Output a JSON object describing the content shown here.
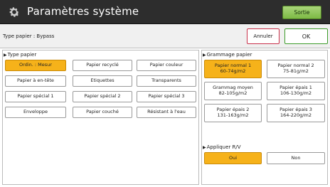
{
  "header": {
    "title": "Paramètres système",
    "exit_label": "Sortie"
  },
  "infobar": {
    "label": "Type papier : Bypass",
    "cancel_label": "Annuler",
    "ok_label": "OK"
  },
  "paper_type": {
    "section_label": "Type papier",
    "buttons": [
      {
        "label": "Ordin. : Mesur"
      },
      {
        "label": "Papier recyclé"
      },
      {
        "label": "Papier couleur"
      },
      {
        "label": "Papier à en-tête"
      },
      {
        "label": "Etiquettes"
      },
      {
        "label": "Transparents"
      },
      {
        "label": "Papier spécial 1"
      },
      {
        "label": "Papier spécial 2"
      },
      {
        "label": "Papier spécial 3"
      },
      {
        "label": "Enveloppe"
      },
      {
        "label": "Papier couché"
      },
      {
        "label": "Résistant à l'eau"
      }
    ],
    "selected": "Ordin. : Mesur"
  },
  "paper_weight": {
    "section_label": "Grammage papier",
    "buttons": [
      {
        "line1": "Papier normal 1",
        "line2": "60-74g/m2"
      },
      {
        "line1": "Papier normal 2",
        "line2": "75-81g/m2"
      },
      {
        "line1": "Grammag moyen",
        "line2": "82-105g/m2"
      },
      {
        "line1": "Papier épais 1",
        "line2": "106-130g/m2"
      },
      {
        "line1": "Papier épais 2",
        "line2": "131-163g/m2"
      },
      {
        "line1": "Papier épais 3",
        "line2": "164-220g/m2"
      }
    ],
    "selected": "Papier normal 1"
  },
  "duplex": {
    "section_label": "Appliquer R/V",
    "yes_label": "Oui",
    "no_label": "Non",
    "selected": "Oui"
  },
  "colors": {
    "selected": "#f6b21a",
    "ok_border": "#3c9c2a",
    "cancel_border": "#c9304a",
    "exit_bg": "#8cc653",
    "titlebar_bg": "#2d2d2d"
  },
  "icons": {
    "title": "gear-icon",
    "section_marker": "triangle-right-icon"
  }
}
